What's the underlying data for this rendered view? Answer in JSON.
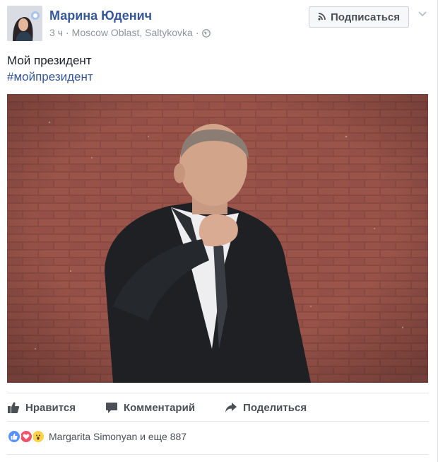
{
  "post": {
    "author": "Марина Юденич",
    "time": "3 ч",
    "location": "Moscow Oblast, Saltykovka",
    "separator": "·",
    "text": "Мой президент",
    "hashtag": "#мойпрезидент"
  },
  "header": {
    "subscribe_label": "Подписаться"
  },
  "actions": {
    "like_label": "Нравится",
    "comment_label": "Комментарий",
    "share_label": "Поделиться"
  },
  "reactions": {
    "summary": "Margarita Simonyan и еще 887",
    "icons": [
      "like-icon",
      "love-icon",
      "wow-icon"
    ]
  },
  "colors": {
    "link": "#365899",
    "meta": "#90949c",
    "action": "#4b4f56",
    "like": "#5890ff",
    "love": "#f25268",
    "wow": "#fcd24d"
  }
}
